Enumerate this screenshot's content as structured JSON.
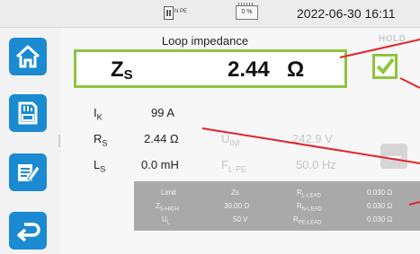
{
  "status_bar": {
    "input_label": "N PE",
    "battery": "0 %",
    "datetime": "2022-06-30  16:11"
  },
  "sidebar": {
    "home_icon": "home-icon",
    "save_icon": "sd-card-icon",
    "report_icon": "report-icon",
    "back_icon": "return-icon"
  },
  "main": {
    "title": "Loop impedance",
    "hold": "HOLD",
    "zs_symbol": "Z",
    "zs_sub": "S",
    "zs_value": "2.44",
    "zs_unit": "Ω",
    "status": "pass"
  },
  "measurements": [
    {
      "sym": "I",
      "sub": "K",
      "value": "99 A"
    },
    {
      "sym": "R",
      "sub": "S",
      "value": "2.44 Ω"
    },
    {
      "sym": "L",
      "sub": "S",
      "value": "0.0 mH"
    }
  ],
  "secondary": [
    {
      "sym": "U",
      "sub": "INI",
      "value": "242.9 V"
    },
    {
      "sym": "F",
      "sub": "L-PE",
      "value": "50.0 Hz"
    }
  ],
  "limits": {
    "rows": [
      {
        "a": "Limit",
        "a_sub": "",
        "b": "Zs",
        "c": "R",
        "c_sub": "L-LEAD",
        "d": "0.030 Ω"
      },
      {
        "a": "Z",
        "a_sub": "S-HIGH",
        "b": "30.00 Ω",
        "c": "R",
        "c_sub": "N-LEAD",
        "d": "0.030 Ω"
      },
      {
        "a": "U",
        "a_sub": "L",
        "b": "50 V",
        "c": "R",
        "c_sub": "PE-LEAD",
        "d": "0.030 Ω"
      }
    ]
  },
  "colors": {
    "accent_blue": "#1a8ad1",
    "pass_green": "#8cc63f",
    "annotation_red": "#e3232b"
  }
}
